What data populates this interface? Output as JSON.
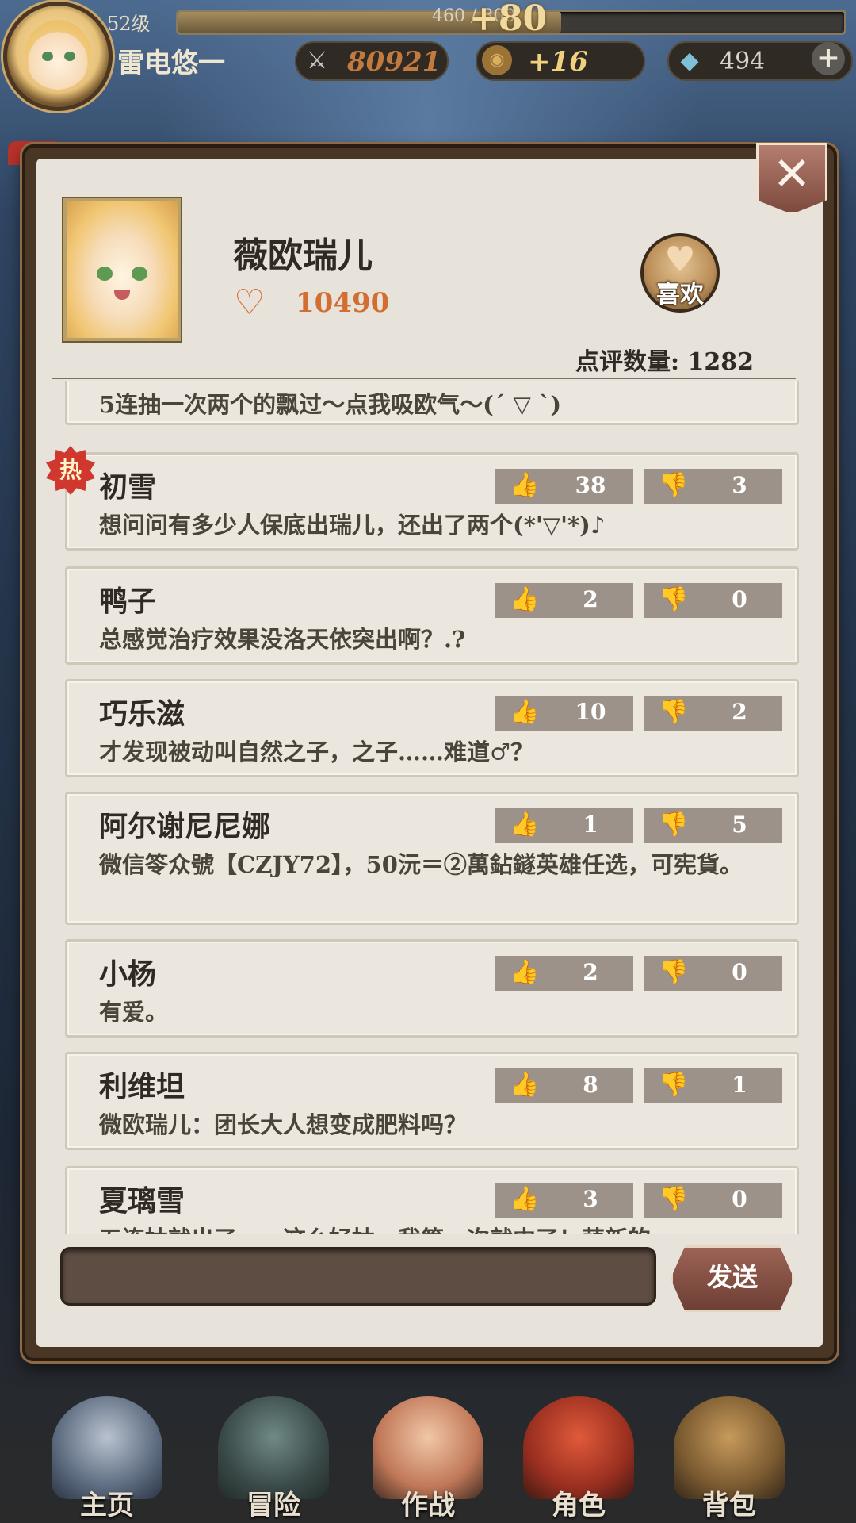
{
  "hud": {
    "level": "52级",
    "player_name": "雷电悠一",
    "exp_text": "460 / 800",
    "exp_fraction": 0.575,
    "exp_gain": "+80",
    "power": "80921",
    "gold": "+16",
    "gems": "494",
    "plus": "+"
  },
  "panel": {
    "close": "✕",
    "character_name": "薇欧瑞儿",
    "favorites": "10490",
    "like_button": "喜欢",
    "review_count": "点评数量: 1282"
  },
  "comments": [
    {
      "user": "",
      "text": "5连抽一次两个的飘过～点我吸欧气～(´ ▽ `)",
      "up": "",
      "down": ""
    },
    {
      "user": "初雪",
      "text": "想问问有多少人保底出瑞儿，还出了两个(*'▽'*)♪",
      "up": "38",
      "down": "3",
      "hot": "热"
    },
    {
      "user": "鸭子",
      "text": "总感觉治疗效果没洛天依突出啊？.?",
      "up": "2",
      "down": "0"
    },
    {
      "user": "巧乐滋",
      "text": "才发现被动叫自然之子，之子……难道♂？",
      "up": "10",
      "down": "2"
    },
    {
      "user": "阿尔谢尼尼娜",
      "text": "微信笭众號【CZJY72】，50沅＝②萬鉆鐩英雄任选，可宪貨。",
      "up": "1",
      "down": "5"
    },
    {
      "user": "小杨",
      "text": "有爱。",
      "up": "2",
      "down": "0"
    },
    {
      "user": "利维坦",
      "text": "微欧瑞儿：团长大人想变成肥料吗？",
      "up": "8",
      "down": "1"
    },
    {
      "user": "夏璃雪",
      "text": "五连抽就出了……这么好抽，我第一次就中了！萌新的",
      "up": "3",
      "down": "0"
    }
  ],
  "input": {
    "placeholder": "",
    "send": "发送"
  },
  "nav": [
    {
      "label": "主页"
    },
    {
      "label": "冒险"
    },
    {
      "label": "作战"
    },
    {
      "label": "角色"
    },
    {
      "label": "背包"
    }
  ],
  "icons": {
    "thumb_up": "thumbs-up-icon",
    "thumb_down": "thumbs-down-icon",
    "heart": "heart-icon",
    "sword": "crossed-swords-icon",
    "coin": "coin-icon",
    "gem": "gem-icon"
  },
  "colors": {
    "accent_orange": "#d36e32",
    "vote_bg": "#9d928a",
    "hot_red": "#d0382f",
    "panel_bg": "#e7e3da"
  }
}
